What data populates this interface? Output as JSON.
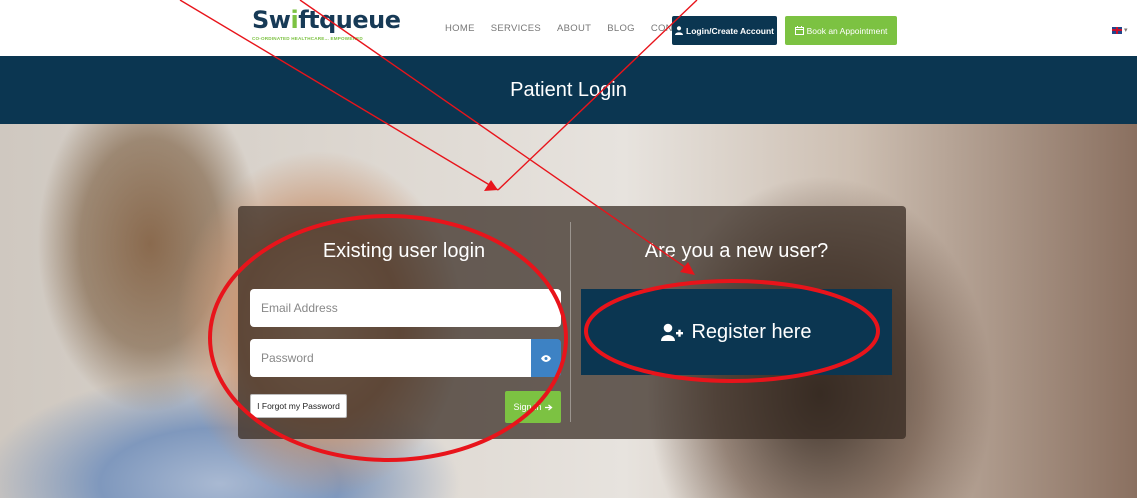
{
  "brand": {
    "logo_main": "Swiftqueue",
    "logo_tag": "CO-ORDINATED HEALTHCARE... EMPOWERED"
  },
  "nav": {
    "items": [
      "HOME",
      "SERVICES",
      "ABOUT",
      "BLOG",
      "CONTACT"
    ],
    "login_button": "Login/Create Account",
    "book_button": "Book an Appointment"
  },
  "page": {
    "title": "Patient Login"
  },
  "login": {
    "heading": "Existing user login",
    "email_placeholder": "Email Address",
    "password_placeholder": "Password",
    "forgot_label": "I Forgot my Password",
    "signin_label": "Sign In"
  },
  "register": {
    "heading": "Are you a new user?",
    "button_label": "Register here"
  },
  "colors": {
    "navy": "#0b3651",
    "green": "#7cc242",
    "blue": "#3d82c4",
    "annotation_red": "#e8141b"
  },
  "icons": [
    "user-icon",
    "calendar-icon",
    "flag-uk-icon",
    "eye-icon",
    "arrow-right-icon",
    "user-plus-icon"
  ]
}
